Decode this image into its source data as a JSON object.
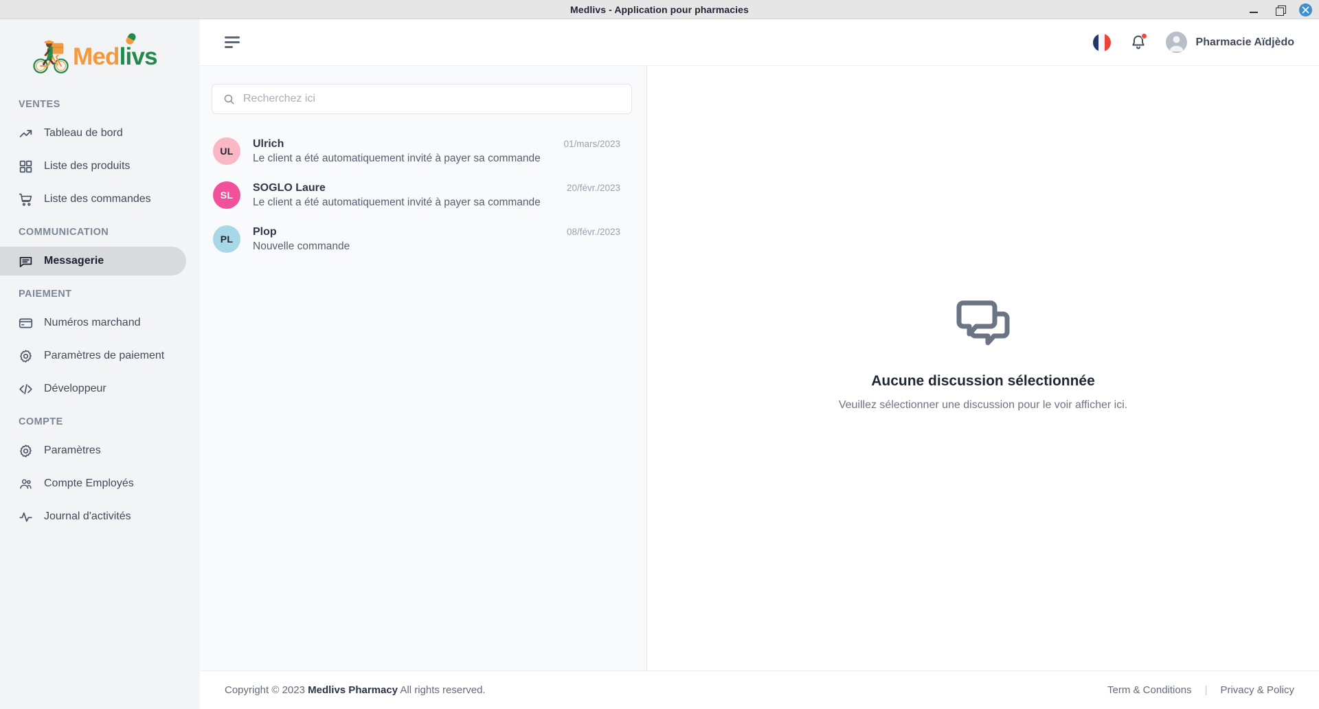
{
  "window": {
    "title": "Medlivs - Application pour pharmacies",
    "controls": {
      "minimize": "minimize-button",
      "maximize": "maximize-button",
      "close": "close-button"
    }
  },
  "brand": {
    "name_part1": "Med",
    "name_part2": "livs"
  },
  "sidebar": {
    "sections": [
      {
        "label": "VENTES",
        "items": [
          {
            "label": "Tableau de bord",
            "icon": "trending-up-icon",
            "active": false
          },
          {
            "label": "Liste des produits",
            "icon": "grid-icon",
            "active": false
          },
          {
            "label": "Liste des commandes",
            "icon": "shopping-cart-icon",
            "active": false
          }
        ]
      },
      {
        "label": "COMMUNICATION",
        "items": [
          {
            "label": "Messagerie",
            "icon": "chat-icon",
            "active": true
          }
        ]
      },
      {
        "label": "PAIEMENT",
        "items": [
          {
            "label": "Numéros marchand",
            "icon": "credit-card-icon",
            "active": false
          },
          {
            "label": "Paramètres de paiement",
            "icon": "gear-icon",
            "active": false
          },
          {
            "label": "Développeur",
            "icon": "code-icon",
            "active": false
          }
        ]
      },
      {
        "label": "COMPTE",
        "items": [
          {
            "label": "Paramètres",
            "icon": "gear-icon",
            "active": false
          },
          {
            "label": "Compte Employés",
            "icon": "users-icon",
            "active": false
          },
          {
            "label": "Journal d'activités",
            "icon": "activity-icon",
            "active": false
          }
        ]
      }
    ]
  },
  "topbar": {
    "menu_toggle": "hamburger-icon",
    "language": "français",
    "notifications_icon": "bell-icon",
    "has_notification": true,
    "user_name": "Pharmacie Aïdjèdo"
  },
  "search": {
    "placeholder": "Recherchez ici",
    "value": "",
    "icon": "search-icon"
  },
  "conversations": [
    {
      "initials": "UL",
      "name": "Ulrich",
      "message": "Le client a été automatiquement invité à payer sa commande",
      "date": "01/mars/2023",
      "avatar_bg": "#f9b8c4",
      "avatar_fg": "#1f2733"
    },
    {
      "initials": "SL",
      "name": "SOGLO Laure",
      "message": "Le client a été automatiquement invité à payer sa commande",
      "date": "20/févr./2023",
      "avatar_bg": "#f2509a",
      "avatar_fg": "#ffffff"
    },
    {
      "initials": "PL",
      "name": "Plop",
      "message": "Nouvelle commande",
      "date": "08/févr./2023",
      "avatar_bg": "#a8d8e8",
      "avatar_fg": "#1f2733"
    }
  ],
  "empty_state": {
    "icon": "chat-bubbles-icon",
    "title": "Aucune discussion sélectionnée",
    "subtitle": "Veuillez sélectionner une discussion pour le voir afficher ici."
  },
  "footer": {
    "copyright_prefix": "Copyright © 2023 ",
    "copyright_brand": "Medlivs Pharmacy",
    "copyright_suffix": " All rights reserved.",
    "terms": "Term & Conditions",
    "separator": "|",
    "privacy": "Privacy & Policy"
  },
  "colors": {
    "brand_orange": "#f5993d",
    "brand_green": "#1f8a4c",
    "accent_blue": "#3d8fd4",
    "notification_red": "#f4453a",
    "sidebar_bg": "#f3f4f6",
    "active_item_bg": "#d8dade"
  }
}
